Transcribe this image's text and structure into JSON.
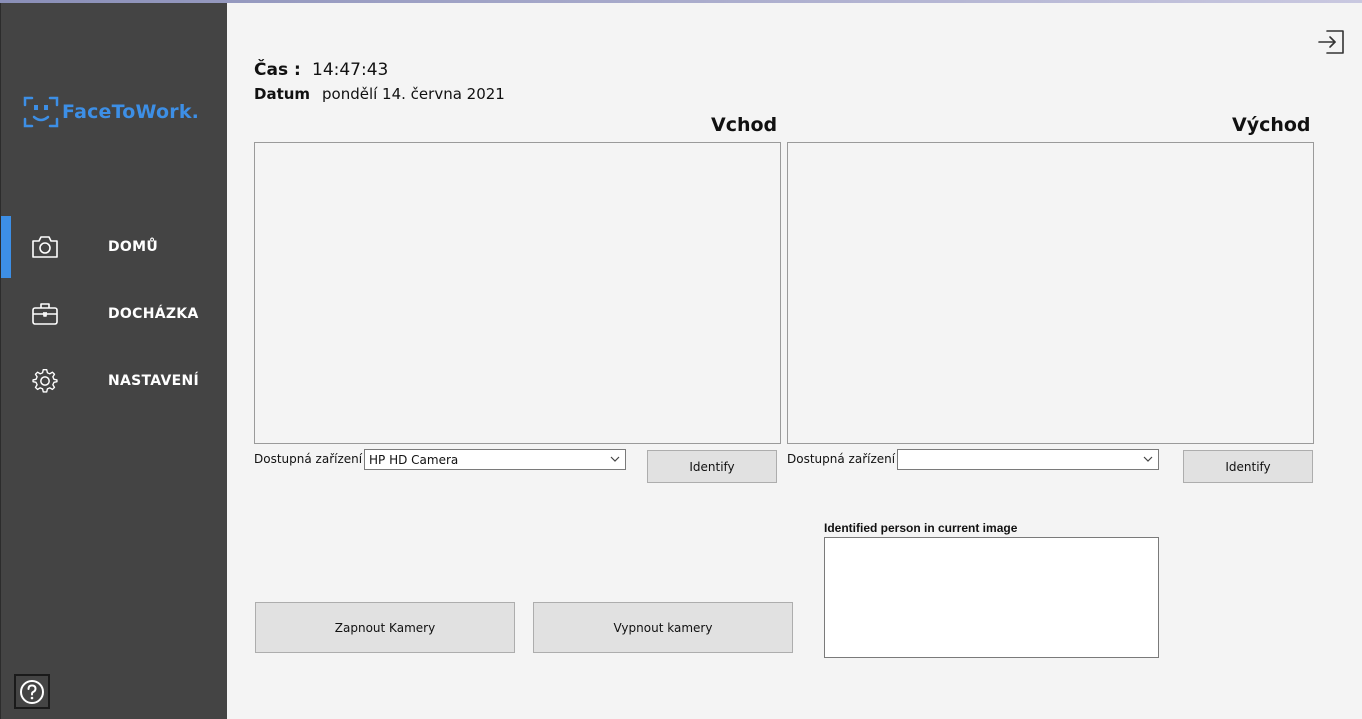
{
  "app": {
    "logo_text": "FaceToWork.",
    "brand_color": "#3d8fe6",
    "sidebar_color": "#444444"
  },
  "sidebar": {
    "items": [
      {
        "label": "DOMŮ",
        "icon": "camera-icon",
        "active": true
      },
      {
        "label": "DOCHÁZKA",
        "icon": "briefcase-icon",
        "active": false
      },
      {
        "label": "NASTAVENÍ",
        "icon": "gear-icon",
        "active": false
      }
    ],
    "help_icon": "question-icon"
  },
  "header": {
    "time_label": "Čas :",
    "time_value": "14:47:43",
    "date_label": "Datum",
    "date_value": "pondělí 14. června 2021",
    "logout_icon": "logout-icon"
  },
  "entry": {
    "title": "Vchod",
    "device_label": "Dostupná zařízení",
    "device_value": "HP HD Camera",
    "identify_label": "Identify"
  },
  "exit": {
    "title": "Východ",
    "device_label": "Dostupná zařízení",
    "device_value": "",
    "identify_label": "Identify"
  },
  "controls": {
    "start_label": "Zapnout Kamery",
    "stop_label": "Vypnout kamery"
  },
  "identified": {
    "label": "Identified person in current image",
    "value": ""
  }
}
